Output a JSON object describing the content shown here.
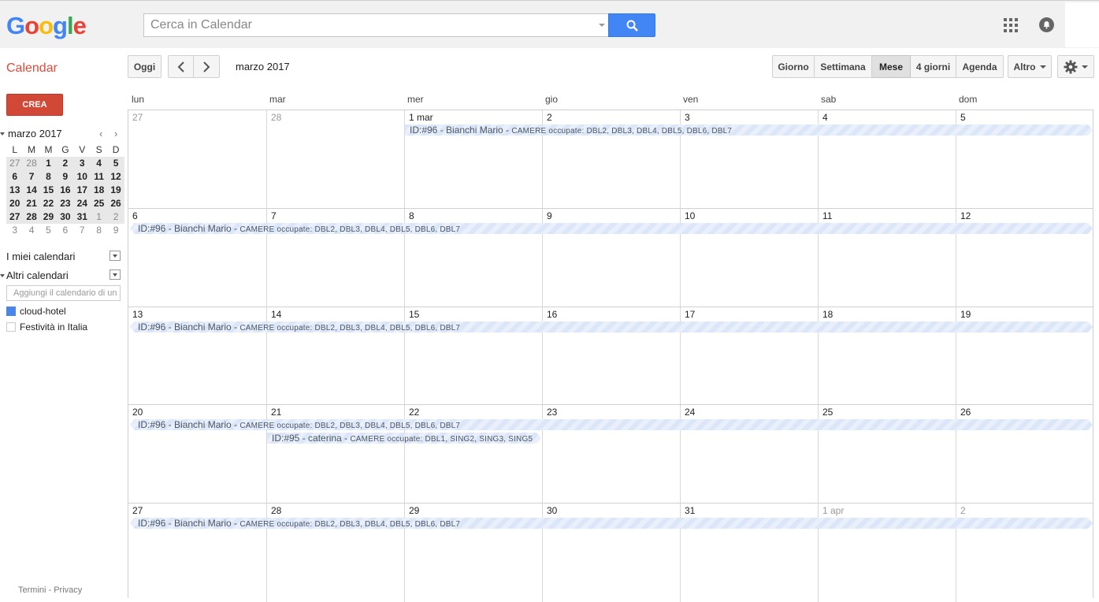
{
  "header": {
    "logo_text": "Google",
    "search_placeholder": "Cerca in Calendar"
  },
  "toolbar": {
    "app_title": "Calendar",
    "today_label": "Oggi",
    "date_range": "marzo 2017",
    "views": [
      "Giorno",
      "Settimana",
      "Mese",
      "4 giorni",
      "Agenda"
    ],
    "active_view": "Mese",
    "more_label": "Altro"
  },
  "sidebar": {
    "create_label": "CREA",
    "mini_calendar": {
      "title": "marzo 2017",
      "weekdays": [
        "L",
        "M",
        "M",
        "G",
        "V",
        "S",
        "D"
      ],
      "weeks": [
        [
          "27",
          "28",
          "1",
          "2",
          "3",
          "4",
          "5"
        ],
        [
          "6",
          "7",
          "8",
          "9",
          "10",
          "11",
          "12"
        ],
        [
          "13",
          "14",
          "15",
          "16",
          "17",
          "18",
          "19"
        ],
        [
          "20",
          "21",
          "22",
          "23",
          "24",
          "25",
          "26"
        ],
        [
          "27",
          "28",
          "29",
          "30",
          "31",
          "1",
          "2"
        ],
        [
          "3",
          "4",
          "5",
          "6",
          "7",
          "8",
          "9"
        ]
      ]
    },
    "my_calendars_label": "I miei calendari",
    "other_calendars_label": "Altri calendari",
    "add_calendar_placeholder": "Aggiungi il calendario di un amico",
    "calendars": [
      {
        "name": "cloud-hotel",
        "color": "#4a86e8"
      },
      {
        "name": "Festività in Italia",
        "color": "#ffffff"
      }
    ],
    "footer": "Termini - Privacy"
  },
  "month": {
    "weekday_headers": [
      "lun",
      "mar",
      "mer",
      "gio",
      "ven",
      "sab",
      "dom"
    ],
    "weeks": [
      [
        "27",
        "28",
        "1 mar",
        "2",
        "3",
        "4",
        "5"
      ],
      [
        "6",
        "7",
        "8",
        "9",
        "10",
        "11",
        "12"
      ],
      [
        "13",
        "14",
        "15",
        "16",
        "17",
        "18",
        "19"
      ],
      [
        "20",
        "21",
        "22",
        "23",
        "24",
        "25",
        "26"
      ],
      [
        "27",
        "28",
        "29",
        "30",
        "31",
        "1 apr",
        "2"
      ]
    ],
    "events": [
      {
        "id": "ID:#96 - Bianchi Mario - ",
        "detail": "CAMERE occupate: DBL2, DBL3, DBL4, DBL5, DBL6, DBL7"
      },
      {
        "id": "ID:#95 - caterina - ",
        "detail": "CAMERE occupate: DBL1, SING2, SING3, SING5"
      }
    ]
  }
}
